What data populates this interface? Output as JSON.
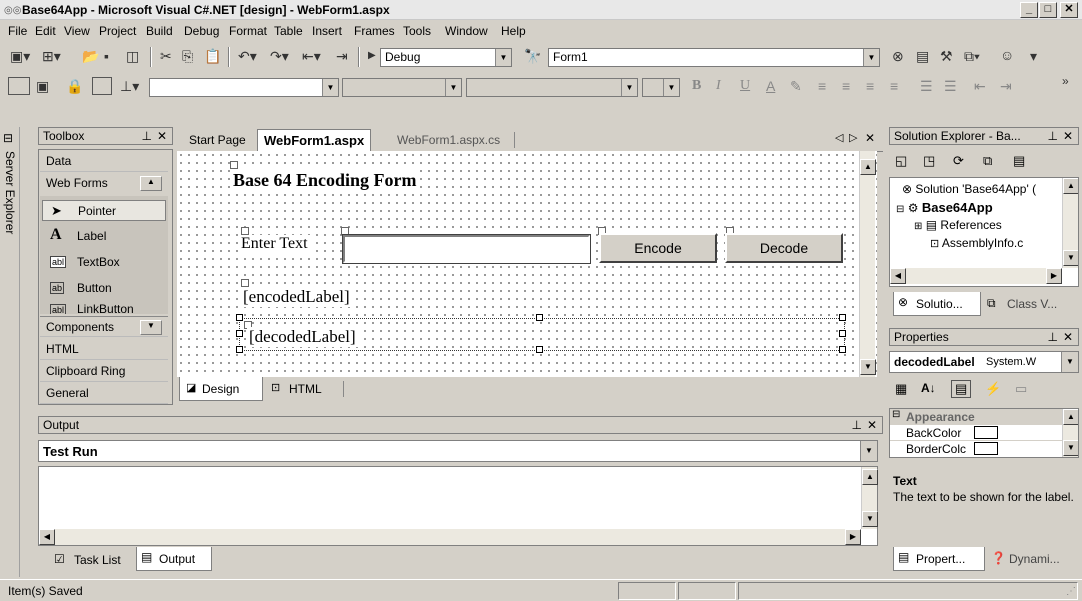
{
  "window": {
    "title": "Base64App - Microsoft Visual C#.NET [design] - WebForm1.aspx"
  },
  "menu": [
    "File",
    "Edit",
    "View",
    "Project",
    "Build",
    "Debug",
    "Format",
    "Table",
    "Insert",
    "Frames",
    "Tools",
    "Window",
    "Help"
  ],
  "toolbar": {
    "config": "Debug",
    "target": "Form1"
  },
  "toolbox": {
    "title": "Toolbox",
    "sections": {
      "data": "Data",
      "webforms": "Web Forms",
      "components": "Components",
      "html": "HTML",
      "clipboard": "Clipboard Ring",
      "general": "General"
    },
    "tools": [
      "Pointer",
      "Label",
      "TextBox",
      "Button",
      "LinkButton"
    ]
  },
  "server_explorer": "Server Explorer",
  "doc_tabs": [
    "Start Page",
    "WebForm1.aspx",
    "WebForm1.aspx.cs"
  ],
  "form": {
    "heading": "Base 64 Encoding Form",
    "enter_label": "Enter Text",
    "encode": "Encode",
    "decode": "Decode",
    "encoded_label": "[encodedLabel]",
    "decoded_label": "[decodedLabel]"
  },
  "view_tabs": [
    "Design",
    "HTML"
  ],
  "solution_explorer": {
    "title": "Solution Explorer - Ba...",
    "items": [
      "Solution 'Base64App' (",
      "Base64App",
      "References",
      "AssemblyInfo.c"
    ],
    "tabs": [
      "Solutio...",
      "Class V..."
    ]
  },
  "properties": {
    "title": "Properties",
    "object": "decodedLabel",
    "object_type": "System.W",
    "category": "Appearance",
    "rows": [
      "BackColor",
      "BorderColc"
    ],
    "desc_title": "Text",
    "desc_body": "The text to be shown for the label.",
    "tabs": [
      "Propert...",
      "Dynami..."
    ]
  },
  "output": {
    "title": "Output",
    "pane": "Test Run",
    "tabs": [
      "Task List",
      "Output"
    ]
  },
  "status": {
    "text": "Item(s) Saved"
  }
}
